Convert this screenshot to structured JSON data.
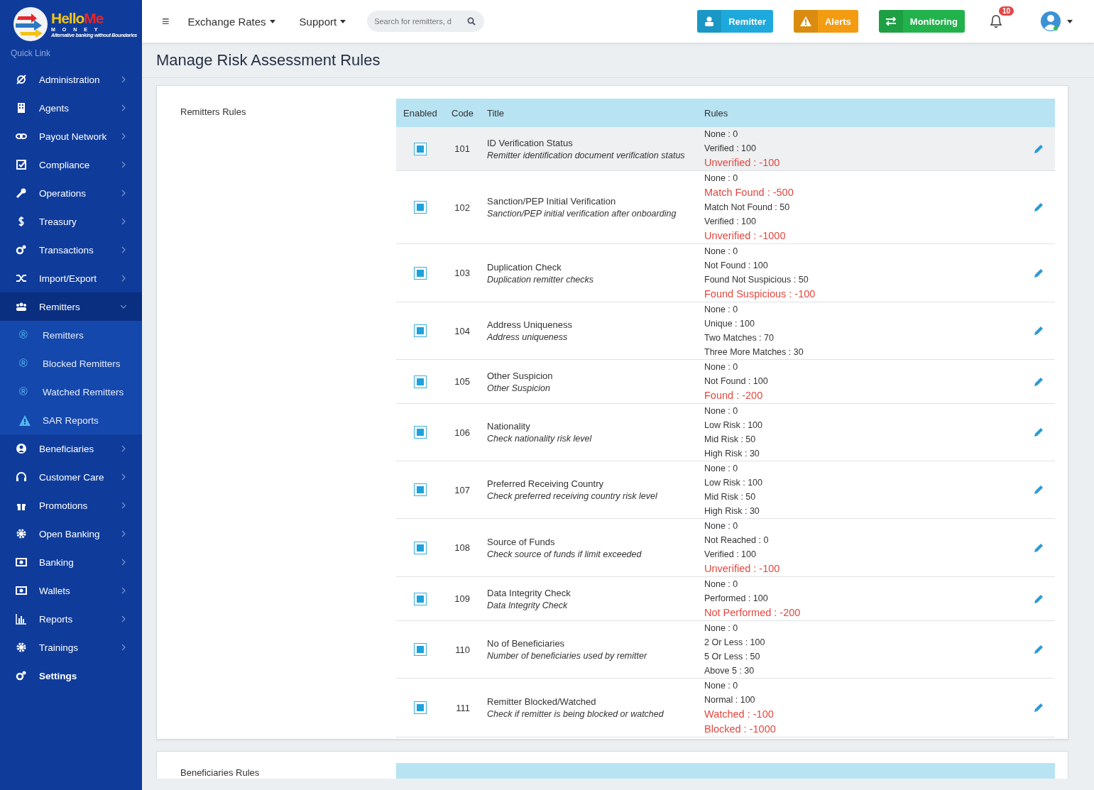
{
  "logo": {
    "name_parts": [
      {
        "text": "Hello",
        "color": "#f2c314"
      },
      {
        "text": "Me",
        "color": "#e3262d"
      }
    ],
    "subtitle": "M O N E Y",
    "tagline": "Alternative banking without Boundaries"
  },
  "sidebar": {
    "heading": "Quick Link",
    "items": [
      {
        "label": "Administration",
        "kind": "menu",
        "expanded": false
      },
      {
        "label": "Agents",
        "kind": "menu",
        "expanded": false
      },
      {
        "label": "Payout Network",
        "kind": "menu",
        "expanded": false
      },
      {
        "label": "Compliance",
        "kind": "menu",
        "expanded": false
      },
      {
        "label": "Operations",
        "kind": "menu",
        "expanded": false
      },
      {
        "label": "Treasury",
        "kind": "menu",
        "expanded": false
      },
      {
        "label": "Transactions",
        "kind": "menu",
        "expanded": false
      },
      {
        "label": "Import/Export",
        "kind": "menu",
        "expanded": false
      },
      {
        "label": "Remitters",
        "kind": "menu",
        "expanded": true,
        "children": [
          {
            "label": "Remitters",
            "glyph": "®"
          },
          {
            "label": "Blocked Remitters",
            "glyph": "®"
          },
          {
            "label": "Watched Remitters",
            "glyph": "®"
          },
          {
            "label": "SAR Reports"
          }
        ]
      },
      {
        "label": "Beneficiaries",
        "kind": "menu",
        "expanded": false
      },
      {
        "label": "Customer Care",
        "kind": "menu",
        "expanded": false
      },
      {
        "label": "Promotions",
        "kind": "menu",
        "expanded": false
      },
      {
        "label": "Open Banking",
        "kind": "menu",
        "expanded": false
      },
      {
        "label": "Banking",
        "kind": "menu",
        "expanded": false
      },
      {
        "label": "Wallets",
        "kind": "menu",
        "expanded": false
      },
      {
        "label": "Reports",
        "kind": "menu",
        "expanded": false
      },
      {
        "label": "Trainings",
        "kind": "menu",
        "expanded": false
      },
      {
        "label": "Settings",
        "kind": "link"
      }
    ]
  },
  "topbar": {
    "menu_glyph": "≡",
    "menus": [
      "Exchange Rates",
      "Support"
    ],
    "search": {
      "placeholder": "Search for remitters, d"
    },
    "buttons": [
      {
        "label": "Remitter",
        "color": "#1ea9dc"
      },
      {
        "label": "Alerts",
        "color": "#f39c12"
      },
      {
        "label": "Monitoring",
        "color": "#22b24c"
      }
    ],
    "notifications": {
      "count": "10"
    }
  },
  "page": {
    "title": "Manage Risk Assessment Rules"
  },
  "sections": [
    {
      "label": "Remitters Rules",
      "columns": [
        "Enabled",
        "Code",
        "Title",
        "Rules"
      ],
      "rows": [
        {
          "enabled": true,
          "selected": true,
          "code": "101",
          "title": "ID Verification Status",
          "description": "Remitter identification document verification status",
          "rules": [
            {
              "text": "None : 0",
              "alert": false
            },
            {
              "text": "Verified : 100",
              "alert": false
            },
            {
              "text": "Unverified : -100",
              "alert": true
            }
          ]
        },
        {
          "enabled": true,
          "selected": false,
          "code": "102",
          "title": "Sanction/PEP Initial Verification",
          "description": "Sanction/PEP initial verification after onboarding",
          "rules": [
            {
              "text": "None : 0",
              "alert": false
            },
            {
              "text": "Match Found : -500",
              "alert": true
            },
            {
              "text": "Match Not Found : 50",
              "alert": false
            },
            {
              "text": "Verified : 100",
              "alert": false
            },
            {
              "text": "Unverified : -1000",
              "alert": true
            }
          ]
        },
        {
          "enabled": true,
          "selected": false,
          "code": "103",
          "title": "Duplication Check",
          "description": "Duplication remitter checks",
          "rules": [
            {
              "text": "None : 0",
              "alert": false
            },
            {
              "text": "Not Found : 100",
              "alert": false
            },
            {
              "text": "Found Not Suspicious : 50",
              "alert": false
            },
            {
              "text": "Found Suspicious : -100",
              "alert": true
            }
          ]
        },
        {
          "enabled": true,
          "selected": false,
          "code": "104",
          "title": "Address Uniqueness",
          "description": "Address uniqueness",
          "rules": [
            {
              "text": "None : 0",
              "alert": false
            },
            {
              "text": "Unique : 100",
              "alert": false
            },
            {
              "text": "Two Matches : 70",
              "alert": false
            },
            {
              "text": "Three More Matches : 30",
              "alert": false
            }
          ]
        },
        {
          "enabled": true,
          "selected": false,
          "code": "105",
          "title": "Other Suspicion",
          "description": "Other Suspicion",
          "rules": [
            {
              "text": "None : 0",
              "alert": false
            },
            {
              "text": "Not Found : 100",
              "alert": false
            },
            {
              "text": "Found : -200",
              "alert": true
            }
          ]
        },
        {
          "enabled": true,
          "selected": false,
          "code": "106",
          "title": "Nationality",
          "description": "Check nationality risk level",
          "rules": [
            {
              "text": "None : 0",
              "alert": false
            },
            {
              "text": "Low Risk : 100",
              "alert": false
            },
            {
              "text": "Mid Risk : 50",
              "alert": false
            },
            {
              "text": "High Risk : 30",
              "alert": false
            }
          ]
        },
        {
          "enabled": true,
          "selected": false,
          "code": "107",
          "title": "Preferred Receiving Country",
          "description": "Check preferred receiving country risk level",
          "rules": [
            {
              "text": "None : 0",
              "alert": false
            },
            {
              "text": "Low Risk : 100",
              "alert": false
            },
            {
              "text": "Mid Risk : 50",
              "alert": false
            },
            {
              "text": "High Risk : 30",
              "alert": false
            }
          ]
        },
        {
          "enabled": true,
          "selected": false,
          "code": "108",
          "title": "Source of Funds",
          "description": "Check source of funds if limit exceeded",
          "rules": [
            {
              "text": "None : 0",
              "alert": false
            },
            {
              "text": "Not Reached : 0",
              "alert": false
            },
            {
              "text": "Verified : 100",
              "alert": false
            },
            {
              "text": "Unverified : -100",
              "alert": true
            }
          ]
        },
        {
          "enabled": true,
          "selected": false,
          "code": "109",
          "title": "Data Integrity Check",
          "description": "Data Integrity Check",
          "rules": [
            {
              "text": "None : 0",
              "alert": false
            },
            {
              "text": "Performed : 100",
              "alert": false
            },
            {
              "text": "Not Performed : -200",
              "alert": true
            }
          ]
        },
        {
          "enabled": true,
          "selected": false,
          "code": "110",
          "title": "No of Beneficiaries",
          "description": "Number of beneficiaries used by remitter",
          "rules": [
            {
              "text": "None : 0",
              "alert": false
            },
            {
              "text": "2 Or Less : 100",
              "alert": false
            },
            {
              "text": "5 Or Less : 50",
              "alert": false
            },
            {
              "text": "Above 5 : 30",
              "alert": false
            }
          ]
        },
        {
          "enabled": true,
          "selected": false,
          "code": "111",
          "title": "Remitter Blocked/Watched",
          "description": "Check if remitter is being blocked or watched",
          "rules": [
            {
              "text": "None : 0",
              "alert": false
            },
            {
              "text": "Normal : 100",
              "alert": false
            },
            {
              "text": "Watched : -100",
              "alert": true
            },
            {
              "text": "Blocked : -1000",
              "alert": true
            }
          ]
        }
      ]
    },
    {
      "label": "Beneficiaries Rules"
    }
  ]
}
